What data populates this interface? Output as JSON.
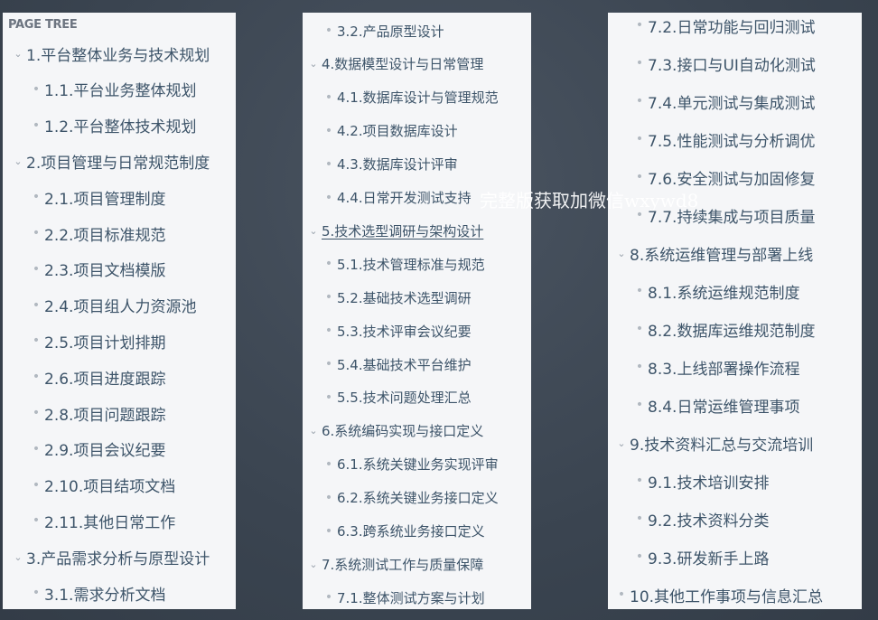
{
  "panel1": {
    "header": "PAGE TREE",
    "items": [
      {
        "label": "1.平台整体业务与技术规划",
        "kind": "parent"
      },
      {
        "label": "1.1.平台业务整体规划",
        "kind": "child"
      },
      {
        "label": "1.2.平台整体技术规划",
        "kind": "child"
      },
      {
        "label": "2.项目管理与日常规范制度",
        "kind": "parent"
      },
      {
        "label": "2.1.项目管理制度",
        "kind": "child"
      },
      {
        "label": "2.2.项目标准规范",
        "kind": "child"
      },
      {
        "label": "2.3.项目文档模版",
        "kind": "child"
      },
      {
        "label": "2.4.项目组人力资源池",
        "kind": "child"
      },
      {
        "label": "2.5.项目计划排期",
        "kind": "child"
      },
      {
        "label": "2.6.项目进度跟踪",
        "kind": "child"
      },
      {
        "label": "2.8.项目问题跟踪",
        "kind": "child"
      },
      {
        "label": "2.9.项目会议纪要",
        "kind": "child"
      },
      {
        "label": "2.10.项目结项文档",
        "kind": "child"
      },
      {
        "label": "2.11.其他日常工作",
        "kind": "child"
      },
      {
        "label": "3.产品需求分析与原型设计",
        "kind": "parent"
      },
      {
        "label": "3.1.需求分析文档",
        "kind": "child"
      }
    ]
  },
  "panel2": {
    "items": [
      {
        "label": "3.2.产品原型设计",
        "kind": "child"
      },
      {
        "label": "4.数据模型设计与日常管理",
        "kind": "parent"
      },
      {
        "label": "4.1.数据库设计与管理规范",
        "kind": "child"
      },
      {
        "label": "4.2.项目数据库设计",
        "kind": "child"
      },
      {
        "label": "4.3.数据库设计评审",
        "kind": "child"
      },
      {
        "label": "4.4.日常开发测试支持",
        "kind": "child"
      },
      {
        "label": "5.技术选型调研与架构设计",
        "kind": "parent",
        "underline": true
      },
      {
        "label": "5.1.技术管理标准与规范",
        "kind": "child"
      },
      {
        "label": "5.2.基础技术选型调研",
        "kind": "child"
      },
      {
        "label": "5.3.技术评审会议纪要",
        "kind": "child"
      },
      {
        "label": "5.4.基础技术平台维护",
        "kind": "child"
      },
      {
        "label": "5.5.技术问题处理汇总",
        "kind": "child"
      },
      {
        "label": "6.系统编码实现与接口定义",
        "kind": "parent"
      },
      {
        "label": "6.1.系统关键业务实现评审",
        "kind": "child"
      },
      {
        "label": "6.2.系统关键业务接口定义",
        "kind": "child"
      },
      {
        "label": "6.3.跨系统业务接口定义",
        "kind": "child"
      },
      {
        "label": "7.系统测试工作与质量保障",
        "kind": "parent"
      },
      {
        "label": "7.1.整体测试方案与计划",
        "kind": "child"
      }
    ]
  },
  "panel3": {
    "items": [
      {
        "label": "7.2.日常功能与回归测试",
        "kind": "child"
      },
      {
        "label": "7.3.接口与UI自动化测试",
        "kind": "child"
      },
      {
        "label": "7.4.单元测试与集成测试",
        "kind": "child"
      },
      {
        "label": "7.5.性能测试与分析调优",
        "kind": "child"
      },
      {
        "label": "7.6.安全测试与加固修复",
        "kind": "child"
      },
      {
        "label": "7.7.持续集成与项目质量",
        "kind": "child"
      },
      {
        "label": "8.系统运维管理与部署上线",
        "kind": "parent"
      },
      {
        "label": "8.1.系统运维规范制度",
        "kind": "child"
      },
      {
        "label": "8.2.数据库运维规范制度",
        "kind": "child"
      },
      {
        "label": "8.3.上线部署操作流程",
        "kind": "child"
      },
      {
        "label": "8.4.日常运维管理事项",
        "kind": "child"
      },
      {
        "label": "9.技术资料汇总与交流培训",
        "kind": "parent"
      },
      {
        "label": "9.1.技术培训安排",
        "kind": "child"
      },
      {
        "label": "9.2.技术资料分类",
        "kind": "child"
      },
      {
        "label": "9.3.研发新手上路",
        "kind": "child"
      },
      {
        "label": "10.其他工作事项与信息汇总",
        "kind": "leaf"
      }
    ]
  },
  "watermark": "完整版获取加微信wxywd8",
  "icons": {
    "expanded": "chevron-down-icon",
    "bullet": "bullet-icon"
  }
}
